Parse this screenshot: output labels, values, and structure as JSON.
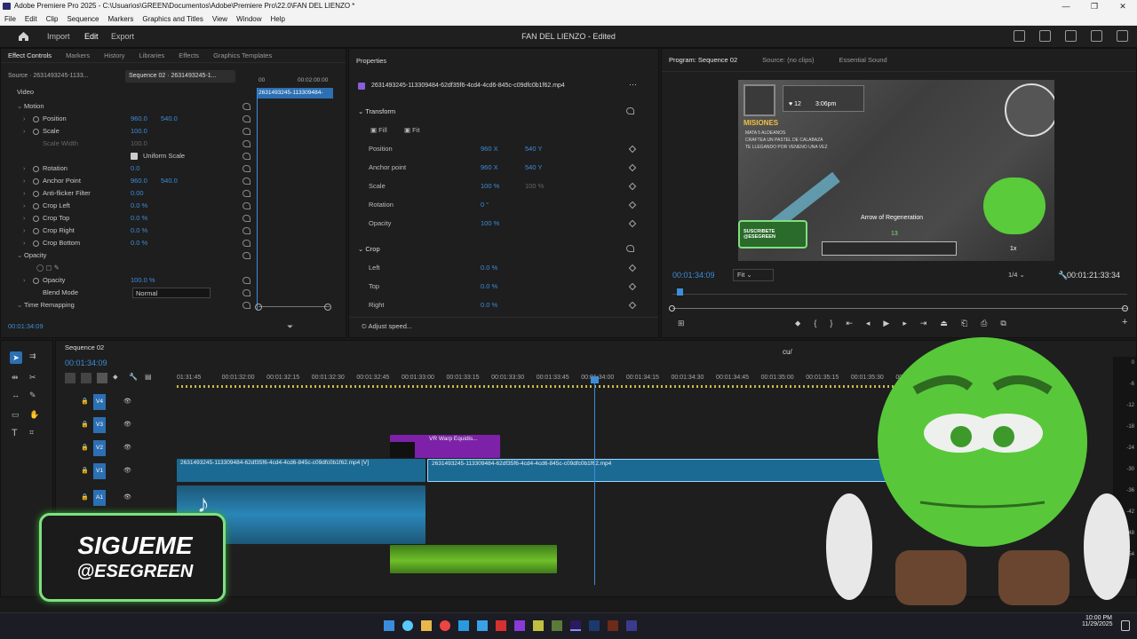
{
  "window": {
    "title": "Adobe Premiere Pro 2025 - C:\\Usuarios\\GREEN\\Documentos\\Adobe\\Premiere Pro\\22.0\\FAN DEL LIENZO *",
    "controls": [
      "—",
      "❐",
      "✕"
    ]
  },
  "menu": [
    "File",
    "Edit",
    "Clip",
    "Sequence",
    "Markers",
    "Graphics and Titles",
    "View",
    "Window",
    "Help"
  ],
  "header": {
    "workspaces": [
      "Import",
      "Edit",
      "Export"
    ],
    "active_workspace": "Edit",
    "project_title": "FAN DEL LIENZO - Edited"
  },
  "effect_controls": {
    "tabs": [
      "Effect Controls",
      "Markers",
      "History",
      "Libraries",
      "Effects",
      "Graphics Templates"
    ],
    "source_tab": "Source · 2631493245-1133...",
    "sequence_tab": "Sequence 02 · 2631493245-1...",
    "mini_ruler": [
      "00",
      "00:02:00:00"
    ],
    "mini_clip": "2631493245-113309484-",
    "section": "Video",
    "rows": [
      {
        "label": "Motion",
        "v1": "",
        "v2": "",
        "kind": "group"
      },
      {
        "label": "Position",
        "v1": "960.0",
        "v2": "540.0",
        "kind": "param"
      },
      {
        "label": "Scale",
        "v1": "100.0",
        "v2": "",
        "kind": "param"
      },
      {
        "label": "Scale Width",
        "v1": "100.0",
        "v2": "",
        "kind": "disabled"
      },
      {
        "label": "Uniform Scale",
        "v1": "",
        "v2": "",
        "kind": "check"
      },
      {
        "label": "Rotation",
        "v1": "0.0",
        "v2": "",
        "kind": "param"
      },
      {
        "label": "Anchor Point",
        "v1": "960.0",
        "v2": "540.0",
        "kind": "param"
      },
      {
        "label": "Anti-flicker Filter",
        "v1": "0.00",
        "v2": "",
        "kind": "param"
      },
      {
        "label": "Crop Left",
        "v1": "0.0 %",
        "v2": "",
        "kind": "param"
      },
      {
        "label": "Crop Top",
        "v1": "0.0 %",
        "v2": "",
        "kind": "param"
      },
      {
        "label": "Crop Right",
        "v1": "0.0 %",
        "v2": "",
        "kind": "param"
      },
      {
        "label": "Crop Bottom",
        "v1": "0.0 %",
        "v2": "",
        "kind": "param"
      },
      {
        "label": "Opacity",
        "v1": "",
        "v2": "",
        "kind": "group"
      },
      {
        "label": "",
        "v1": "",
        "v2": "",
        "kind": "masks"
      },
      {
        "label": "Opacity",
        "v1": "100.0 %",
        "v2": "",
        "kind": "param"
      },
      {
        "label": "Blend Mode",
        "v1": "Normal",
        "v2": "",
        "kind": "select"
      },
      {
        "label": "Time Remapping",
        "v1": "",
        "v2": "",
        "kind": "group"
      }
    ],
    "timecode": "00:01:34:09"
  },
  "properties": {
    "title": "Properties",
    "clip_name": "2631493245-113309484-62df35f6-4cd4-4cd6-845c-c09dfc0b1f62.mp4",
    "transform": "Transform",
    "fill": "Fill",
    "fit": "Fit",
    "rows": [
      {
        "label": "Position",
        "v1": "960 X",
        "v2": "540 Y"
      },
      {
        "label": "Anchor point",
        "v1": "960 X",
        "v2": "540 Y"
      },
      {
        "label": "Scale",
        "v1": "100 %",
        "v2": "100 %"
      },
      {
        "label": "Rotation",
        "v1": "0 °",
        "v2": ""
      },
      {
        "label": "Opacity",
        "v1": "100 %",
        "v2": ""
      }
    ],
    "crop": "Crop",
    "crop_rows": [
      {
        "label": "Left",
        "v1": "0.0 %"
      },
      {
        "label": "Top",
        "v1": "0.0 %"
      },
      {
        "label": "Right",
        "v1": "0.0 %"
      }
    ],
    "adjust_speed": "Adjust speed..."
  },
  "program": {
    "tabs": [
      "Program: Sequence 02",
      "Source: (no clips)",
      "Essential Sound"
    ],
    "timecode": "00:01:34:09",
    "fit": "Fit",
    "quality": "1/4",
    "duration": "00:01:21:33:34",
    "playhead_fraction": 0.01,
    "game": {
      "hearts": "12",
      "time": "3:06pm",
      "title": "MISIONES",
      "mission_lines": [
        "MATA 5 ALDEANOS",
        "CRAFTEA UN PASTEL DE CALABAZA",
        "TE LLEGANDO POR VENENO UNA VEZ"
      ],
      "effect": "Arrow of Regeneration",
      "level": "13",
      "badge": "SUSCRIBETE @ESEGREEN",
      "speed": "1x"
    }
  },
  "timeline": {
    "sequence": "Sequence 02",
    "timecode": "00:01:34:09",
    "ruler": [
      "01:31:45",
      "00:01:32:00",
      "00:01:32:15",
      "00:01:32:30",
      "00:01:32:45",
      "00:01:33:00",
      "00:01:33:15",
      "00:01:33:30",
      "00:01:33:45",
      "00:01:34:00",
      "00:01:34:15",
      "00:01:34:30",
      "00:01:34:45",
      "00:01:35:00",
      "00:01:35:15",
      "00:01:35:30",
      "00:01:35:45"
    ],
    "tracks": [
      "V4",
      "V3",
      "V2",
      "V1",
      "A1"
    ],
    "clips": {
      "warp": "VR Warp Equidis...",
      "v1_left": "2631493245-113309484-62df35f6-4cd4-4cd6-845c-c09dfc0b1f62.mp4 [V]",
      "v1_right": "2631493245-113309484-62df35f6-4cd4-4cd6-845c-c09dfc0b1f62.mp4"
    },
    "marker_text": "cu/",
    "meter_ticks": [
      "0",
      "-6",
      "-12",
      "-18",
      "-24",
      "-30",
      "-36",
      "-42",
      "-48",
      "-54"
    ]
  },
  "overlay": {
    "badge_line1": "SIGUEME",
    "badge_line2": "@ESEGREEN"
  },
  "taskbar": {
    "time": "10:00 PM",
    "date": "11/29/2025"
  }
}
